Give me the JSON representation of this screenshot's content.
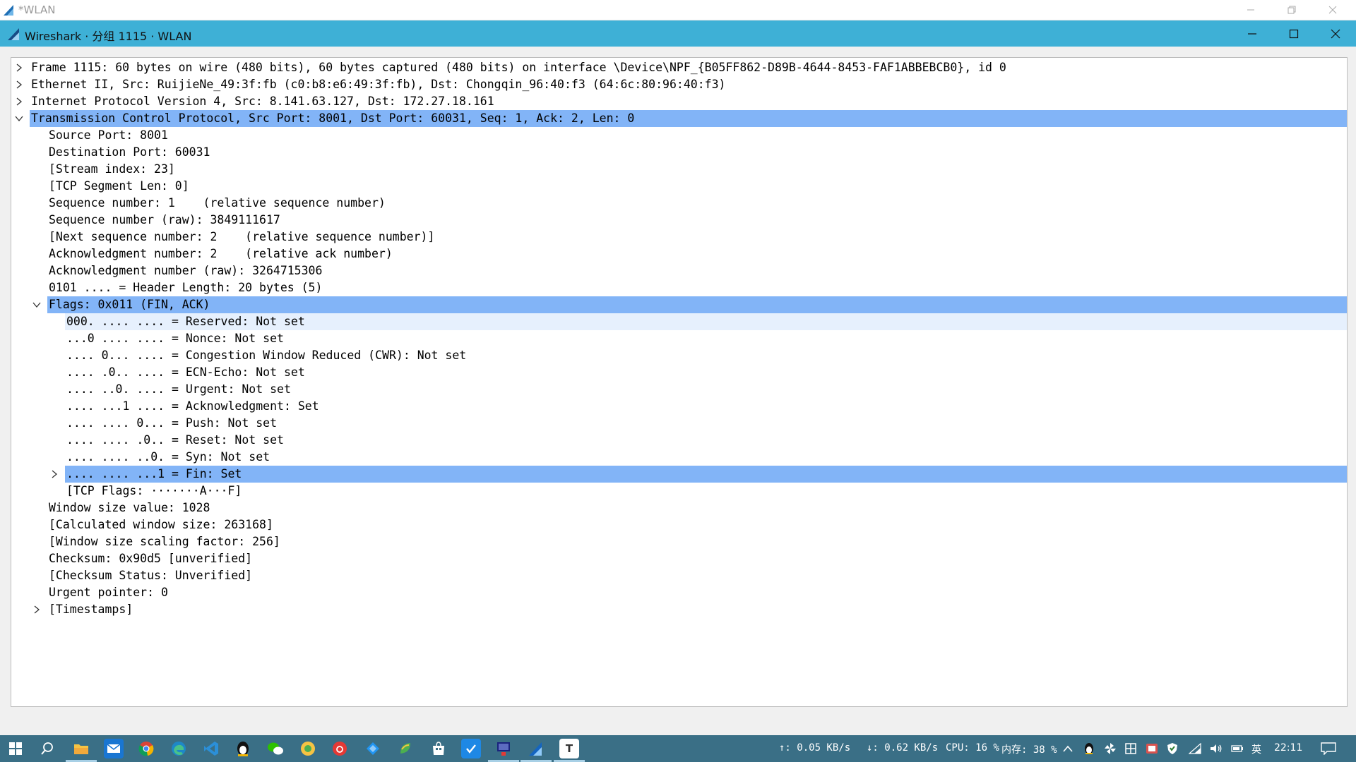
{
  "outer_window": {
    "title": "*WLAN"
  },
  "window": {
    "title": "Wireshark · 分组 1115 · WLAN"
  },
  "tree": [
    {
      "text": "Frame 1115: 60 bytes on wire (480 bits), 60 bytes captured (480 bits) on interface \\Device\\NPF_{B05FF862-D89B-4644-8453-FAF1ABBEBCB0}, id 0",
      "indent": 0,
      "expander": "collapsed",
      "state": "none"
    },
    {
      "text": "Ethernet II, Src: RuijieNe_49:3f:fb (c0:b8:e6:49:3f:fb), Dst: Chongqin_96:40:f3 (64:6c:80:96:40:f3)",
      "indent": 0,
      "expander": "collapsed",
      "state": "none"
    },
    {
      "text": "Internet Protocol Version 4, Src: 8.141.63.127, Dst: 172.27.18.161",
      "indent": 0,
      "expander": "collapsed",
      "state": "none"
    },
    {
      "text": "Transmission Control Protocol, Src Port: 8001, Dst Port: 60031, Seq: 1, Ack: 2, Len: 0",
      "indent": 0,
      "expander": "expanded",
      "state": "selected"
    },
    {
      "text": "Source Port: 8001",
      "indent": 1,
      "expander": "none",
      "state": "none"
    },
    {
      "text": "Destination Port: 60031",
      "indent": 1,
      "expander": "none",
      "state": "none"
    },
    {
      "text": "[Stream index: 23]",
      "indent": 1,
      "expander": "none",
      "state": "none"
    },
    {
      "text": "[TCP Segment Len: 0]",
      "indent": 1,
      "expander": "none",
      "state": "none"
    },
    {
      "text": "Sequence number: 1    (relative sequence number)",
      "indent": 1,
      "expander": "none",
      "state": "none"
    },
    {
      "text": "Sequence number (raw): 3849111617",
      "indent": 1,
      "expander": "none",
      "state": "none"
    },
    {
      "text": "[Next sequence number: 2    (relative sequence number)]",
      "indent": 1,
      "expander": "none",
      "state": "none"
    },
    {
      "text": "Acknowledgment number: 2    (relative ack number)",
      "indent": 1,
      "expander": "none",
      "state": "none"
    },
    {
      "text": "Acknowledgment number (raw): 3264715306",
      "indent": 1,
      "expander": "none",
      "state": "none"
    },
    {
      "text": "0101 .... = Header Length: 20 bytes (5)",
      "indent": 1,
      "expander": "none",
      "state": "none"
    },
    {
      "text": "Flags: 0x011 (FIN, ACK)",
      "indent": 1,
      "expander": "expanded",
      "state": "selected"
    },
    {
      "text": "000. .... .... = Reserved: Not set",
      "indent": 2,
      "expander": "none",
      "state": "hover"
    },
    {
      "text": "...0 .... .... = Nonce: Not set",
      "indent": 2,
      "expander": "none",
      "state": "none"
    },
    {
      "text": ".... 0... .... = Congestion Window Reduced (CWR): Not set",
      "indent": 2,
      "expander": "none",
      "state": "none"
    },
    {
      "text": ".... .0.. .... = ECN-Echo: Not set",
      "indent": 2,
      "expander": "none",
      "state": "none"
    },
    {
      "text": ".... ..0. .... = Urgent: Not set",
      "indent": 2,
      "expander": "none",
      "state": "none"
    },
    {
      "text": ".... ...1 .... = Acknowledgment: Set",
      "indent": 2,
      "expander": "none",
      "state": "none"
    },
    {
      "text": ".... .... 0... = Push: Not set",
      "indent": 2,
      "expander": "none",
      "state": "none"
    },
    {
      "text": ".... .... .0.. = Reset: Not set",
      "indent": 2,
      "expander": "none",
      "state": "none"
    },
    {
      "text": ".... .... ..0. = Syn: Not set",
      "indent": 2,
      "expander": "none",
      "state": "none"
    },
    {
      "text": ".... .... ...1 = Fin: Set",
      "indent": 2,
      "expander": "collapsed",
      "state": "selected"
    },
    {
      "text": "[TCP Flags: ·······A···F]",
      "indent": 2,
      "expander": "none",
      "state": "none"
    },
    {
      "text": "Window size value: 1028",
      "indent": 1,
      "expander": "none",
      "state": "none"
    },
    {
      "text": "[Calculated window size: 263168]",
      "indent": 1,
      "expander": "none",
      "state": "none"
    },
    {
      "text": "[Window size scaling factor: 256]",
      "indent": 1,
      "expander": "none",
      "state": "none"
    },
    {
      "text": "Checksum: 0x90d5 [unverified]",
      "indent": 1,
      "expander": "none",
      "state": "none"
    },
    {
      "text": "[Checksum Status: Unverified]",
      "indent": 1,
      "expander": "none",
      "state": "none"
    },
    {
      "text": "Urgent pointer: 0",
      "indent": 1,
      "expander": "none",
      "state": "none"
    },
    {
      "text": "[Timestamps]",
      "indent": 1,
      "expander": "collapsed",
      "state": "none"
    }
  ],
  "taskbar": {
    "apps": [
      {
        "name": "start-button",
        "icon": "windows-logo"
      },
      {
        "name": "search-button",
        "icon": "search-icon"
      },
      {
        "name": "file-explorer",
        "icon": "folder-icon"
      },
      {
        "name": "mail",
        "icon": "mail-icon"
      },
      {
        "name": "chrome",
        "icon": "chrome-icon"
      },
      {
        "name": "edge",
        "icon": "edge-icon"
      },
      {
        "name": "vscode",
        "icon": "vscode-icon"
      },
      {
        "name": "qq",
        "icon": "penguin-icon"
      },
      {
        "name": "wechat",
        "icon": "wechat-icon"
      },
      {
        "name": "app-yellow",
        "icon": "circle-icon"
      },
      {
        "name": "netease-music",
        "icon": "music-icon"
      },
      {
        "name": "app-blue-diamond",
        "icon": "diamond-icon"
      },
      {
        "name": "app-leaf",
        "icon": "leaf-icon"
      },
      {
        "name": "store",
        "icon": "store-icon"
      },
      {
        "name": "app-check",
        "icon": "check-icon"
      },
      {
        "name": "app-network",
        "icon": "network-icon"
      },
      {
        "name": "wireshark",
        "icon": "shark-fin-icon"
      },
      {
        "name": "typora",
        "icon": "typora-icon"
      }
    ],
    "upload_speed": "↑: 0.05 KB/s",
    "download_speed": "↓: 0.62 KB/s",
    "cpu": "CPU: 16 %",
    "memory": "内存: 38 %",
    "ime": "英",
    "clock": "22:11"
  },
  "colors": {
    "title_bar": "#3eb0d6",
    "selection": "#82b4f7",
    "hover": "#e6f0fd",
    "taskbar": "#3a6f86"
  }
}
